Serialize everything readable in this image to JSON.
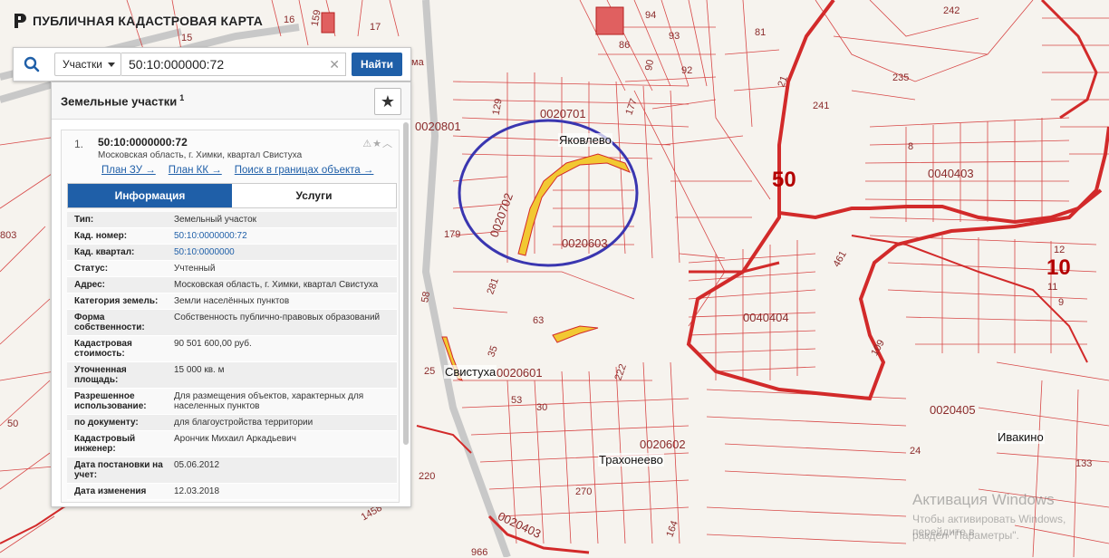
{
  "app": {
    "title": "ПУБЛИЧНАЯ КАДАСТРОВАЯ КАРТА"
  },
  "search": {
    "type_label": "Участки",
    "query": "50:10:000000:72",
    "find_label": "Найти"
  },
  "panel": {
    "title": "Земельные участки",
    "count": "1",
    "result": {
      "index": "1.",
      "number": "50:10:0000000:72",
      "address": "Московская область, г. Химки, квартал Свистуха",
      "links": [
        "План ЗУ →",
        "План КК →",
        "Поиск в границах объекта →"
      ]
    },
    "tabs": [
      "Информация",
      "Услуги"
    ],
    "attributes": [
      {
        "k": "Тип:",
        "v": "Земельный участок"
      },
      {
        "k": "Кад. номер:",
        "v": "50:10:0000000:72"
      },
      {
        "k": "Кад. квартал:",
        "v": "50:10:0000000"
      },
      {
        "k": "Статус:",
        "v": "Учтенный"
      },
      {
        "k": "Адрес:",
        "v": "Московская область, г. Химки, квартал Свистуха"
      },
      {
        "k": "Категория земель:",
        "v": "Земли населённых пунктов"
      },
      {
        "k": "Форма собственности:",
        "v": "Собственность публично-правовых образований"
      },
      {
        "k": "Кадастровая стоимость:",
        "v": "90 501 600,00 руб."
      },
      {
        "k": "Уточненная площадь:",
        "v": "15 000 кв. м"
      },
      {
        "k": "Разрешенное использование:",
        "v": "Для размещения объектов, характерных для населенных пунктов"
      },
      {
        "k": "по документу:",
        "v": "для благоустройства территории"
      },
      {
        "k": "Кадастровый инженер:",
        "v": "Арончик Михаил Аркадьевич"
      },
      {
        "k": "Дата постановки на учет:",
        "v": "05.06.2012"
      },
      {
        "k": "Дата изменения",
        "v": "12.03.2018"
      }
    ]
  },
  "map": {
    "places": [
      "Яковлево",
      "Свистуха",
      "Трахонеево",
      "Ивакино"
    ],
    "quarters": [
      "0020701",
      "0020801",
      "0020702",
      "0020603",
      "0040403",
      "0040404",
      "0020601",
      "0020602",
      "0020405",
      "0020403"
    ],
    "region_numbers": [
      "50",
      "10"
    ],
    "numbers": [
      "159",
      "16",
      "15",
      "94",
      "93",
      "86",
      "90",
      "92",
      "81",
      "242",
      "235",
      "21",
      "241",
      "803",
      "179",
      "129",
      "177",
      "281",
      "63",
      "58",
      "25",
      "220",
      "30",
      "53",
      "270",
      "164",
      "133",
      "12",
      "11",
      "9",
      "50",
      "461",
      "109",
      "24",
      "966",
      "1458",
      "ма",
      "8",
      "17",
      "222",
      "35"
    ],
    "colors": {
      "parcel": "#d22a2a",
      "ellipse": "#3a36b0",
      "highlight": "#f2c832"
    }
  },
  "watermark": {
    "title": "Активация Windows",
    "line1": "Чтобы активировать Windows, перейдите в",
    "line2": "раздел \"Параметры\"."
  }
}
